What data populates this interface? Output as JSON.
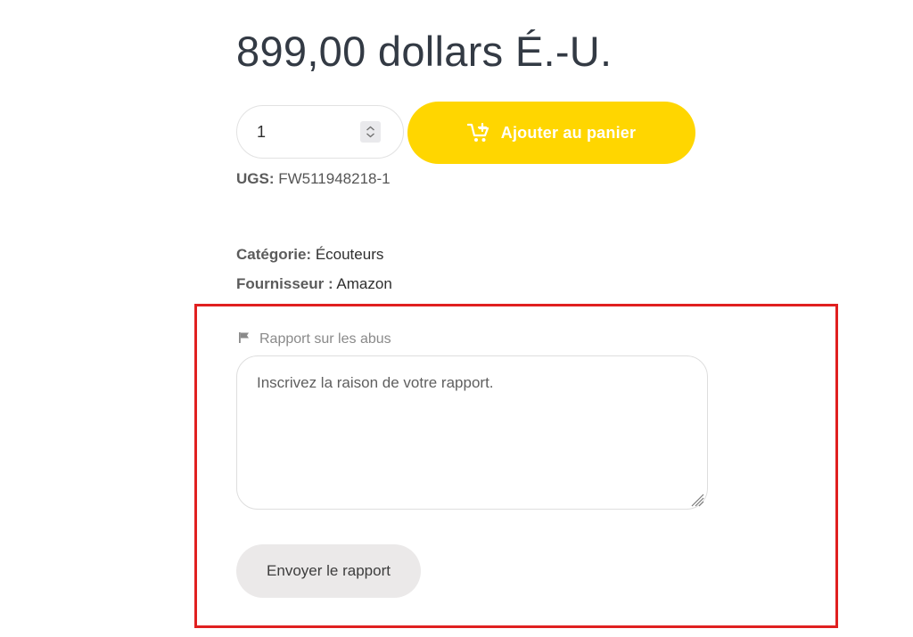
{
  "product": {
    "price": "899,00 dollars É.-U."
  },
  "purchase": {
    "quantity": "1",
    "add_to_cart_label": "Ajouter au panier"
  },
  "meta": {
    "sku_label": "UGS:",
    "sku_value": "FW511948218-1",
    "category_label": "Catégorie:",
    "category_value": "Écouteurs",
    "supplier_label": "Fournisseur :",
    "supplier_value": "Amazon"
  },
  "report": {
    "title": "Rapport sur les abus",
    "placeholder": "Inscrivez la raison de votre rapport.",
    "value": "",
    "submit_label": "Envoyer le rapport"
  },
  "colors": {
    "accent_button": "#ffd600",
    "highlight_frame": "#e02020",
    "secondary_button": "#ebe9e9"
  },
  "icons": {
    "cart": "cart-plus-icon",
    "stepper": "chevron-up-down-icon",
    "flag": "flag-icon",
    "resize": "resize-grip-icon"
  }
}
